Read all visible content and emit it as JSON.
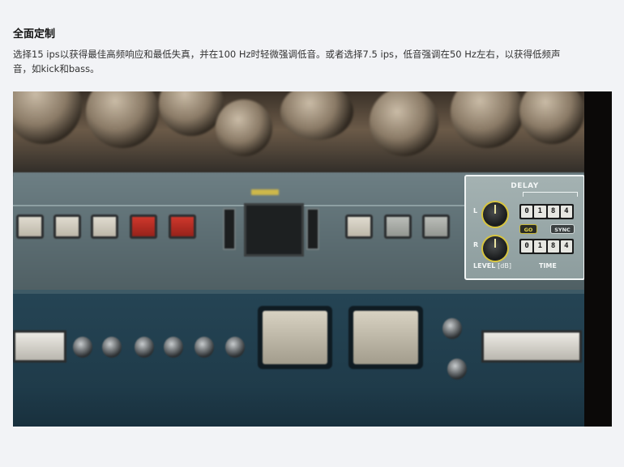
{
  "section": {
    "title": "全面定制",
    "description": "选择15 ips以获得最佳高频响应和最低失真，并在100 Hz时轻微强调低音。或者选择7.5 ips，低音强调在50 Hz左右，以获得低频声音，如kick和bass。"
  },
  "delay_panel": {
    "title": "DELAY",
    "left_label": "L",
    "right_label": "R",
    "left_time_digits": [
      "0",
      "1",
      "8",
      "4"
    ],
    "right_time_digits": [
      "0",
      "1",
      "8",
      "4"
    ],
    "go_label": "GO",
    "sync_label": "SYNC",
    "level_label": "LEVEL",
    "level_unit": "[dB]",
    "time_label": "TIME",
    "accent_color": "#d8c53c"
  }
}
